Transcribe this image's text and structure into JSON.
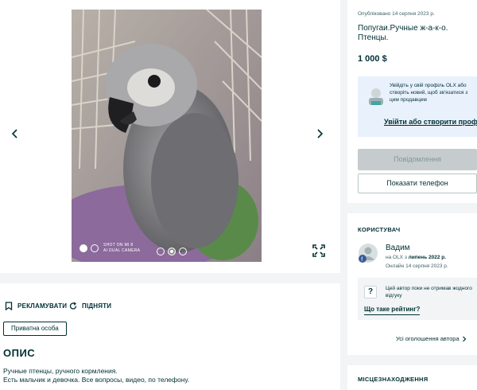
{
  "gallery": {
    "photo_watermark_line1": "SHOT ON MI 8",
    "photo_watermark_line2": "AI DUAL CAMERA",
    "slide_count": 3,
    "active_slide": 2
  },
  "actions": {
    "promote_label": "РЕКЛАМУВАТИ",
    "raise_label": "ПІДНЯТИ"
  },
  "ad": {
    "seller_type": "Приватна особа",
    "description_heading": "ОПИС",
    "description_lines": [
      "Ручные птенцы, ручного кормления.",
      "Есть мальчик и девочка. Все вопросы, видео, по телефону."
    ],
    "posted": "Опубліковано 14 серпня 2023 р.",
    "title": "Попугаи.Ручные ж-а-к-о. Птенцы.",
    "price": "1 000 $"
  },
  "login_prompt": {
    "text": "Увійдіть у свій профіль OLX або створіть новий, щоб зв'язатися з цим продавцем",
    "link": "Увійти або створити профіль"
  },
  "buttons": {
    "message": "Повідомлення",
    "phone": "Показати телефон"
  },
  "user": {
    "heading": "КОРИСТУВАЧ",
    "name": "Вадим",
    "since_prefix": "на OLX з",
    "since_value": "липень 2022 р.",
    "online": "Онлайн 14 серпня 2023 р.",
    "rating_text": "Цей автор поки не отримав жодного відгуку",
    "rating_link": "Що таке рейтинг?",
    "all_ads": "Усі оголошення автора"
  },
  "location": {
    "heading": "МІСЦЕЗНАХОДЖЕННЯ"
  },
  "colors": {
    "brand_text": "#002f34",
    "login_bg": "#e9f1fc",
    "disabled_button": "#c6cccd",
    "page_bg": "#f2f4f5"
  }
}
